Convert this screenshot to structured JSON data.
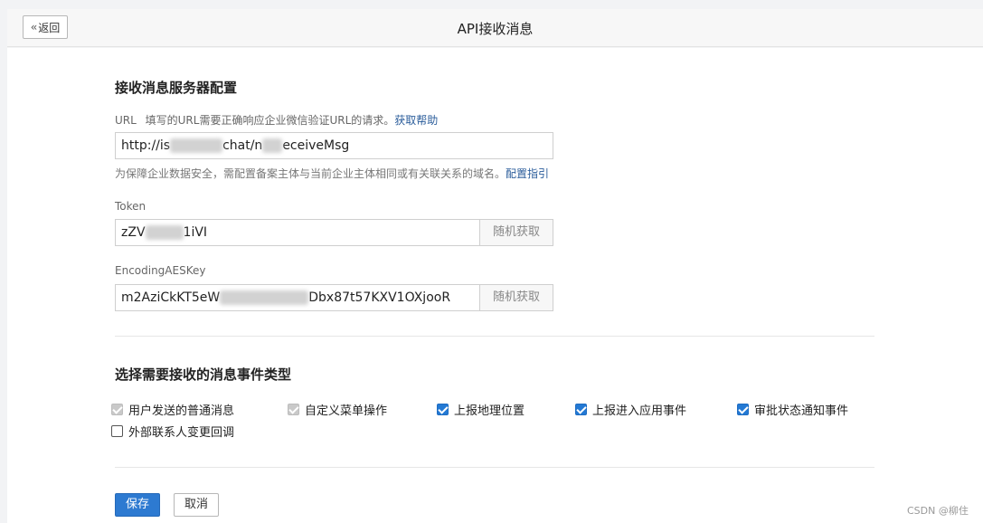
{
  "header": {
    "back_label": "返回",
    "title": "API接收消息"
  },
  "server_config": {
    "section_title": "接收消息服务器配置",
    "url": {
      "label": "URL",
      "hint": "填写的URL需要正确响应企业微信验证URL的请求。",
      "help_link": "获取帮助",
      "value_prefix": "http://is",
      "value_middle": "chat/n",
      "value_suffix": "eceiveMsg",
      "security_hint": "为保障企业数据安全，需配置备案主体与当前企业主体相同或有关联关系的域名。",
      "config_link": "配置指引"
    },
    "token": {
      "label": "Token",
      "value_prefix": "zZV",
      "value_suffix": "1iVI",
      "random_button": "随机获取"
    },
    "aes_key": {
      "label": "EncodingAESKey",
      "value_prefix": "m2AziCkKT5eW",
      "value_suffix": "Dbx87t57KXV1OXjooR",
      "random_button": "随机获取"
    }
  },
  "event_types": {
    "section_title": "选择需要接收的消息事件类型",
    "items": [
      {
        "label": "用户发送的普通消息",
        "state": "disabled"
      },
      {
        "label": "自定义菜单操作",
        "state": "disabled"
      },
      {
        "label": "上报地理位置",
        "state": "checked"
      },
      {
        "label": "上报进入应用事件",
        "state": "checked"
      },
      {
        "label": "审批状态通知事件",
        "state": "checked"
      },
      {
        "label": "外部联系人变更回调",
        "state": "unchecked"
      }
    ]
  },
  "actions": {
    "save_label": "保存",
    "cancel_label": "取消"
  },
  "watermark": "CSDN @柳住",
  "colors": {
    "primary": "#2d7ad1",
    "link": "#2b5d9b",
    "checkbox": "#2379d4"
  }
}
